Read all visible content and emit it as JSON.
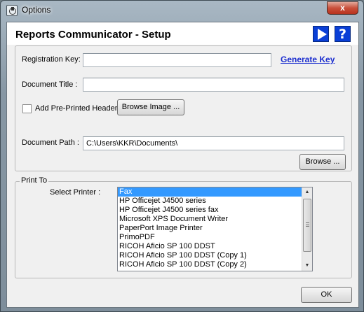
{
  "window": {
    "title": "Options",
    "close_glyph": "x"
  },
  "header": {
    "title": "Reports Communicator - Setup",
    "play_icon": "play-icon",
    "help_glyph": "?"
  },
  "setup": {
    "registration_key_label": "Registration Key:",
    "registration_key_value": "",
    "generate_key_link": "Generate Key",
    "document_title_label": "Document Title :",
    "document_title_value": "",
    "preprinted_header_label": "Add Pre-Printed Header",
    "preprinted_header_checked": false,
    "browse_image_label": "Browse Image ...",
    "document_path_label": "Document Path :",
    "document_path_value": "C:\\Users\\KKR\\Documents\\",
    "browse_label": "Browse ..."
  },
  "print_to": {
    "group_label": "Print To",
    "select_printer_label": "Select Printer :",
    "printers": [
      "Fax",
      "HP Officejet J4500 series",
      "HP Officejet J4500 series fax",
      "Microsoft XPS Document Writer",
      "PaperPort Image Printer",
      "PrimoPDF",
      "RICOH Aficio SP 100 DDST",
      "RICOH Aficio SP 100 DDST (Copy 1)",
      "RICOH Aficio SP 100 DDST (Copy 2)"
    ],
    "selected_printer": "Fax"
  },
  "footer": {
    "ok_label": "OK"
  },
  "colors": {
    "accent_blue": "#0a3fd6",
    "link_blue": "#1d2fcf",
    "selection": "#3399ff"
  }
}
